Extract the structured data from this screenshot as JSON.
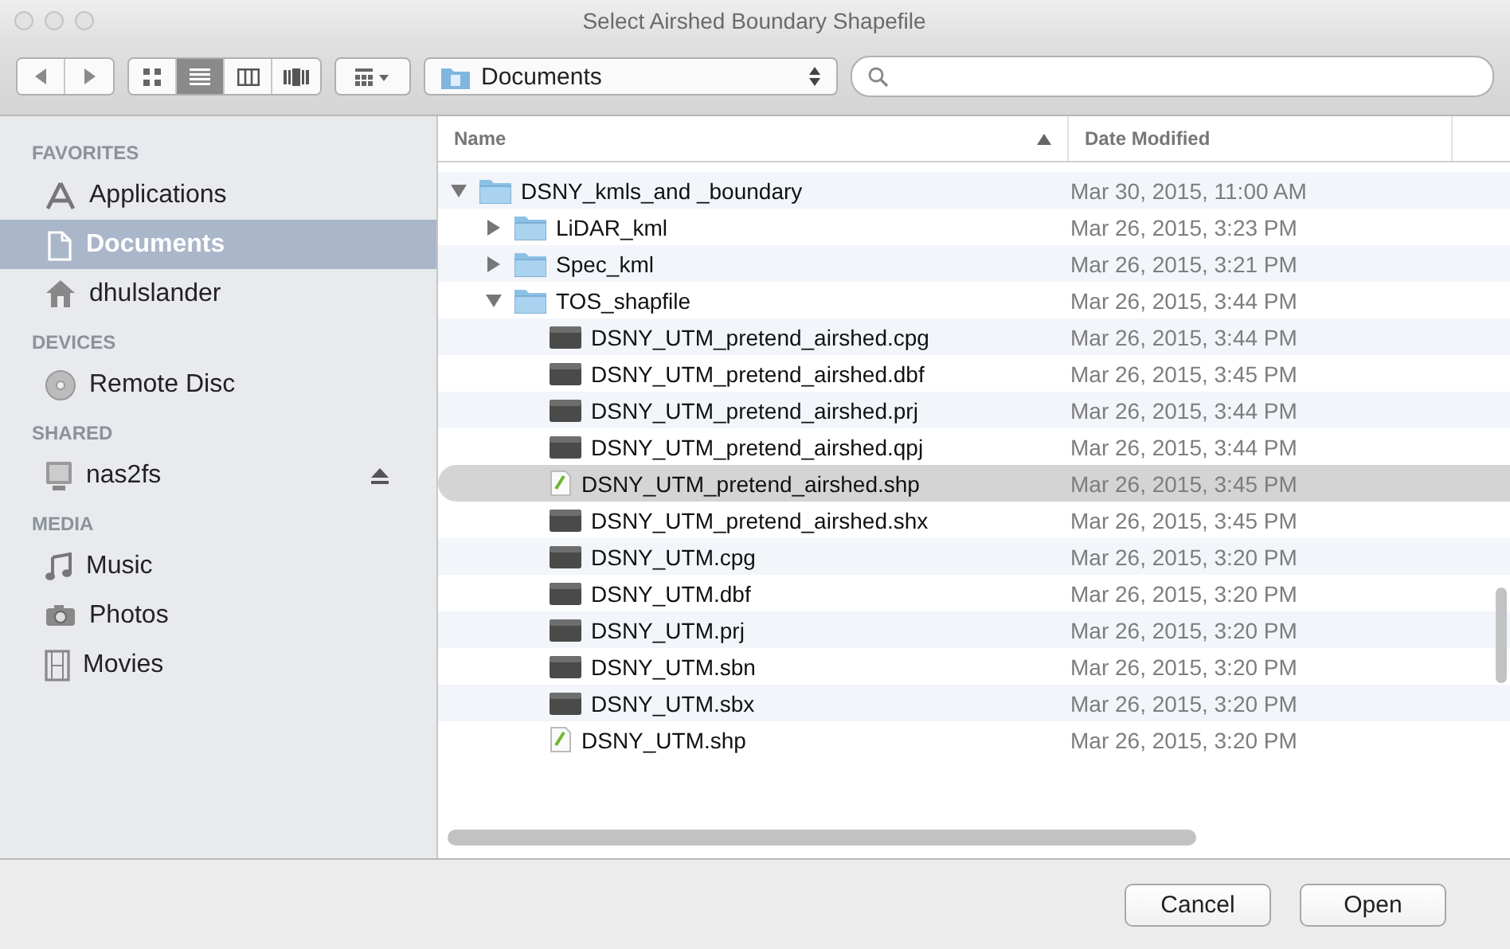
{
  "window": {
    "title": "Select Airshed Boundary Shapefile"
  },
  "toolbar": {
    "views": [
      {
        "kind": "icons",
        "selected": false
      },
      {
        "kind": "list",
        "selected": true
      },
      {
        "kind": "columns",
        "selected": false
      },
      {
        "kind": "coverflow",
        "selected": false
      }
    ],
    "location": "Documents"
  },
  "sidebar": [
    {
      "heading": "FAVORITES",
      "items": [
        {
          "label": "Applications",
          "kind": "applications",
          "selected": false
        },
        {
          "label": "Documents",
          "kind": "documents",
          "selected": true
        },
        {
          "label": "dhulslander",
          "kind": "home",
          "selected": false
        }
      ]
    },
    {
      "heading": "DEVICES",
      "items": [
        {
          "label": "Remote Disc",
          "kind": "disc",
          "selected": false
        }
      ]
    },
    {
      "heading": "SHARED",
      "items": [
        {
          "label": "nas2fs",
          "kind": "server",
          "selected": false,
          "eject": true
        }
      ]
    },
    {
      "heading": "MEDIA",
      "items": [
        {
          "label": "Music",
          "kind": "music",
          "selected": false
        },
        {
          "label": "Photos",
          "kind": "photos",
          "selected": false
        },
        {
          "label": "Movies",
          "kind": "movies",
          "selected": false
        }
      ]
    }
  ],
  "table": {
    "columns": [
      "Name",
      "Date Modified"
    ],
    "rows": [
      {
        "name": "DSNY_kmls_and _boundary",
        "date": "Mar 30, 2015, 11:00 AM",
        "kind": "folder",
        "expanded": true,
        "selected": false,
        "children": [
          {
            "name": "LiDAR_kml",
            "date": "Mar 26, 2015, 3:23 PM",
            "kind": "folder",
            "expanded": false,
            "selected": false
          },
          {
            "name": "Spec_kml",
            "date": "Mar 26, 2015, 3:21 PM",
            "kind": "folder",
            "expanded": false,
            "selected": false
          },
          {
            "name": "TOS_shapfile",
            "date": "Mar 26, 2015, 3:44 PM",
            "kind": "folder",
            "expanded": true,
            "selected": false,
            "children": [
              {
                "name": "DSNY_UTM_pretend_airshed.cpg",
                "date": "Mar 26, 2015, 3:44 PM",
                "kind": "file",
                "selected": false
              },
              {
                "name": "DSNY_UTM_pretend_airshed.dbf",
                "date": "Mar 26, 2015, 3:45 PM",
                "kind": "file",
                "selected": false
              },
              {
                "name": "DSNY_UTM_pretend_airshed.prj",
                "date": "Mar 26, 2015, 3:44 PM",
                "kind": "file",
                "selected": false
              },
              {
                "name": "DSNY_UTM_pretend_airshed.qpj",
                "date": "Mar 26, 2015, 3:44 PM",
                "kind": "file",
                "selected": false
              },
              {
                "name": "DSNY_UTM_pretend_airshed.shp",
                "date": "Mar 26, 2015, 3:45 PM",
                "kind": "shape",
                "selected": true
              },
              {
                "name": "DSNY_UTM_pretend_airshed.shx",
                "date": "Mar 26, 2015, 3:45 PM",
                "kind": "file",
                "selected": false
              },
              {
                "name": "DSNY_UTM.cpg",
                "date": "Mar 26, 2015, 3:20 PM",
                "kind": "file",
                "selected": false
              },
              {
                "name": "DSNY_UTM.dbf",
                "date": "Mar 26, 2015, 3:20 PM",
                "kind": "file",
                "selected": false
              },
              {
                "name": "DSNY_UTM.prj",
                "date": "Mar 26, 2015, 3:20 PM",
                "kind": "file",
                "selected": false
              },
              {
                "name": "DSNY_UTM.sbn",
                "date": "Mar 26, 2015, 3:20 PM",
                "kind": "file",
                "selected": false
              },
              {
                "name": "DSNY_UTM.sbx",
                "date": "Mar 26, 2015, 3:20 PM",
                "kind": "file",
                "selected": false
              },
              {
                "name": "DSNY_UTM.shp",
                "date": "Mar 26, 2015, 3:20 PM",
                "kind": "shape",
                "selected": false
              }
            ]
          }
        ]
      }
    ]
  },
  "buttons": [
    "Cancel",
    "Open"
  ]
}
